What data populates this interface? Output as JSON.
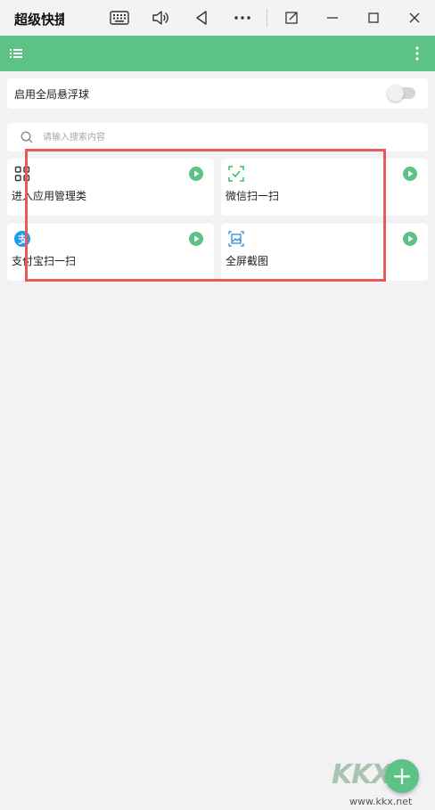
{
  "window": {
    "title": "超级快捷",
    "keyboard_icon": "keyboard-icon",
    "volume_icon": "volume-icon",
    "back_icon": "back-triangle-icon",
    "more_icon": "more-dots-icon",
    "external_icon": "external-window-icon",
    "minimize_icon": "minimize-icon",
    "maximize_icon": "maximize-icon",
    "close_icon": "close-icon"
  },
  "appbar": {
    "color": "#5cc285",
    "menu_icon": "list-menu-icon",
    "more_icon": "vertical-dots-icon"
  },
  "floating_ball": {
    "label": "启用全局悬浮球",
    "enabled": false
  },
  "search": {
    "placeholder": "请输入搜索内容",
    "value": ""
  },
  "shortcuts": [
    {
      "label": "进入应用管理类",
      "icon": "apps-grid-icon"
    },
    {
      "label": "微信扫一扫",
      "icon": "scan-icon"
    },
    {
      "label": "支付宝扫一扫",
      "icon": "alipay-icon"
    },
    {
      "label": "全屏截图",
      "icon": "screenshot-icon"
    }
  ],
  "accent": {
    "green": "#5cc285",
    "highlight_red": "#e85a5a",
    "alipay_blue": "#1a9cf0"
  },
  "watermark": {
    "brand": "KKX下载",
    "url": "www.kkx.net"
  }
}
